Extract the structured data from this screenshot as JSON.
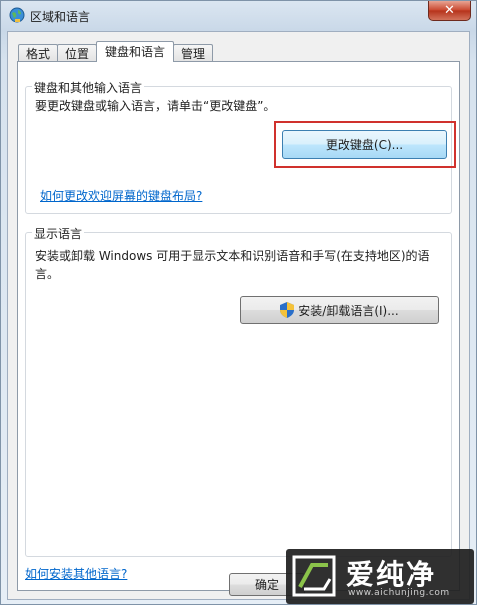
{
  "window": {
    "title": "区域和语言",
    "close_glyph": "✕"
  },
  "tabs": [
    {
      "label": "格式",
      "active": false
    },
    {
      "label": "位置",
      "active": false
    },
    {
      "label": "键盘和语言",
      "active": true
    },
    {
      "label": "管理",
      "active": false
    }
  ],
  "keyboards": {
    "group_label": "键盘和其他输入语言",
    "instruction": "要更改键盘或输入语言，请单击“更改键盘”。",
    "change_button": "更改键盘(C)...",
    "welcome_link": "如何更改欢迎屏幕的键盘布局?"
  },
  "display_language": {
    "group_label": "显示语言",
    "description_line1": "安装或卸载 Windows 可用于显示文本和识别语音和手写(在支持地区)的语",
    "description_line2": "言。",
    "install_button": "安装/卸载语言(I)..."
  },
  "footer": {
    "install_link": "如何安装其他语言?",
    "ok_button": "确定"
  },
  "watermark": {
    "brand": "爱纯净",
    "url": "www.aichunjing.com"
  },
  "colors": {
    "highlight": "#d0312d",
    "link": "#0066cc",
    "close": "#c8452c"
  }
}
